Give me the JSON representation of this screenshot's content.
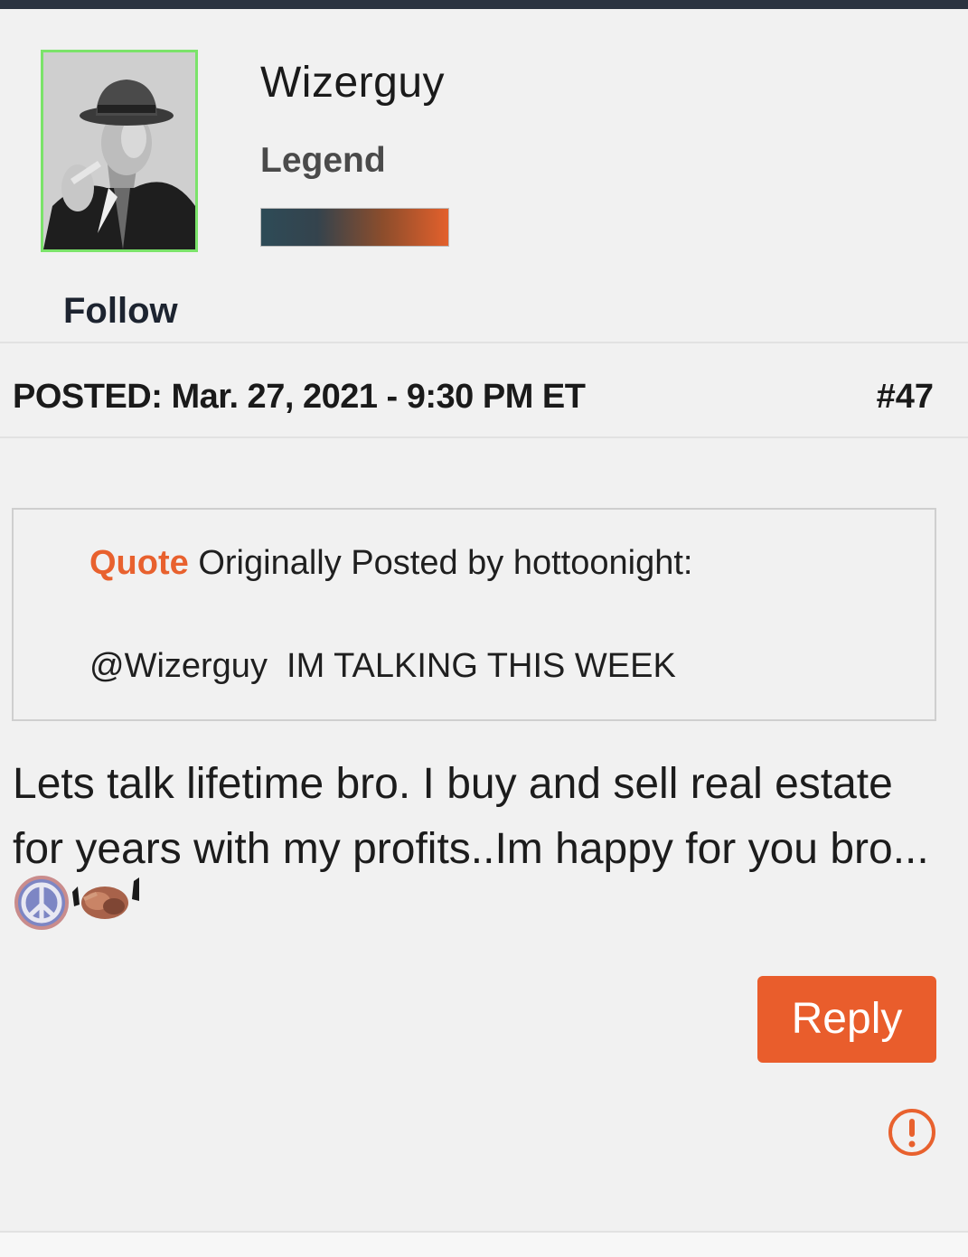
{
  "colors": {
    "accent": "#e95d2c",
    "quote_label": "#e8612e",
    "avatar_border": "#7be36a",
    "top_bar": "#2a3340"
  },
  "user": {
    "name": "Wizerguy",
    "rank": "Legend",
    "follow_label": "Follow",
    "avatar_icon": "user-avatar-photo"
  },
  "post": {
    "posted": "POSTED: Mar. 27, 2021 - 9:30 PM ET",
    "number": "#47",
    "quote": {
      "label": "Quote",
      "attribution": "Originally Posted by hottoonight:",
      "text": "@Wizerguy  IM TALKING THIS WEEK"
    },
    "body": "Lets talk lifetime bro. I buy and sell real estate for years with my profits..Im happy for you bro...",
    "emojis": [
      "peace-icon",
      "handshake-icon"
    ],
    "reply_label": "Reply",
    "report_icon": "report-icon"
  }
}
